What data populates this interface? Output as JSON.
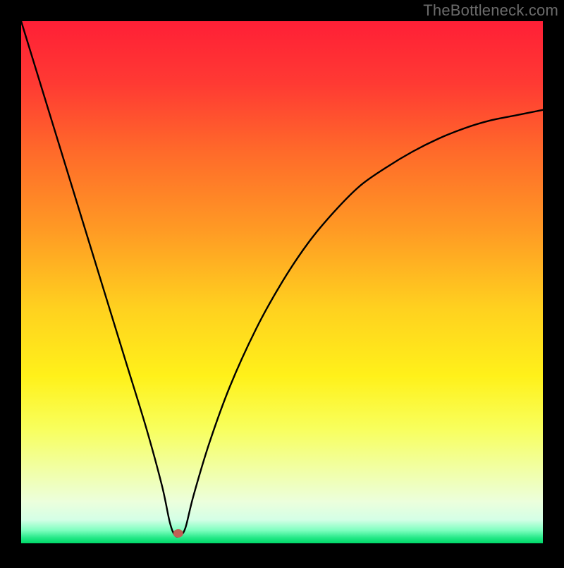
{
  "watermark": "TheBottleneck.com",
  "plot": {
    "inner_x": 30,
    "inner_y": 30,
    "inner_w": 740,
    "inner_h": 740,
    "gradient_stops": [
      {
        "offset": 0.0,
        "color": "#ff1f36"
      },
      {
        "offset": 0.12,
        "color": "#ff3a33"
      },
      {
        "offset": 0.25,
        "color": "#ff6a2a"
      },
      {
        "offset": 0.4,
        "color": "#ff9a24"
      },
      {
        "offset": 0.55,
        "color": "#ffd11f"
      },
      {
        "offset": 0.68,
        "color": "#fff11a"
      },
      {
        "offset": 0.78,
        "color": "#f8ff5c"
      },
      {
        "offset": 0.86,
        "color": "#f1ffa6"
      },
      {
        "offset": 0.92,
        "color": "#ecffdc"
      },
      {
        "offset": 0.955,
        "color": "#d4ffe6"
      },
      {
        "offset": 0.975,
        "color": "#7fffc0"
      },
      {
        "offset": 0.99,
        "color": "#22e886"
      },
      {
        "offset": 1.0,
        "color": "#00d868"
      }
    ],
    "marker": {
      "x_frac": 0.301,
      "y_frac": 0.981,
      "rx": 7,
      "ry": 6,
      "fill": "#c06055"
    }
  },
  "chart_data": {
    "type": "line",
    "title": "",
    "xlabel": "",
    "ylabel": "",
    "xlim": [
      0,
      1
    ],
    "ylim": [
      0,
      1
    ],
    "note": "Axes are normalized 0–1; origin at bottom-left. Curve is a V-shaped dip reaching ≈0 near x≈0.30, rising steeply on both sides.",
    "series": [
      {
        "name": "curve",
        "x": [
          0.0,
          0.04,
          0.08,
          0.12,
          0.16,
          0.2,
          0.24,
          0.27,
          0.285,
          0.295,
          0.305,
          0.315,
          0.33,
          0.36,
          0.4,
          0.45,
          0.5,
          0.55,
          0.6,
          0.65,
          0.7,
          0.75,
          0.8,
          0.85,
          0.9,
          0.95,
          1.0
        ],
        "y": [
          1.0,
          0.87,
          0.74,
          0.61,
          0.48,
          0.35,
          0.22,
          0.11,
          0.04,
          0.015,
          0.015,
          0.03,
          0.09,
          0.19,
          0.3,
          0.41,
          0.5,
          0.575,
          0.635,
          0.685,
          0.72,
          0.75,
          0.775,
          0.795,
          0.81,
          0.82,
          0.83
        ]
      }
    ],
    "marker_point": {
      "x": 0.301,
      "y": 0.019
    }
  }
}
